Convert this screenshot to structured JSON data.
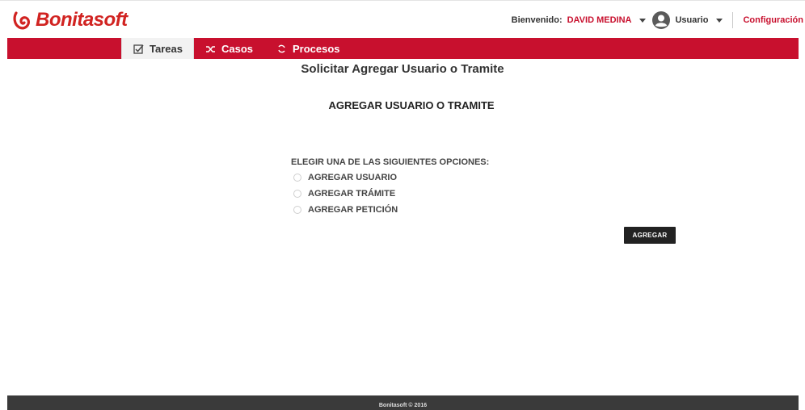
{
  "brand": {
    "name": "Bonitasoft",
    "color": "#d12321",
    "icon": "bonita-logo-icon"
  },
  "user_bar": {
    "welcome_label": "Bienvenido:",
    "user_name": "DAVID MEDINA",
    "profile_label": "Usuario",
    "settings_link": "Configuración",
    "accent_color": "#c8102e"
  },
  "nav": {
    "color": "#c8102e",
    "tabs": [
      {
        "label": "Tareas",
        "icon": "checkbox-icon",
        "active": true
      },
      {
        "label": "Casos",
        "icon": "shuffle-icon",
        "active": false
      },
      {
        "label": "Procesos",
        "icon": "cycle-icon",
        "active": false
      }
    ]
  },
  "page": {
    "title": "Solicitar Agregar Usuario o Tramite"
  },
  "form": {
    "title": "AGREGAR USUARIO O TRAMITE",
    "question": "ELEGIR UNA DE LAS SIGUIENTES OPCIONES:",
    "options": [
      "AGREGAR USUARIO",
      "AGREGAR TRÁMITE",
      "AGREGAR PETICIÓN"
    ],
    "submit_label": "AGREGAR"
  },
  "footer": {
    "text": "Bonitasoft © 2016"
  }
}
